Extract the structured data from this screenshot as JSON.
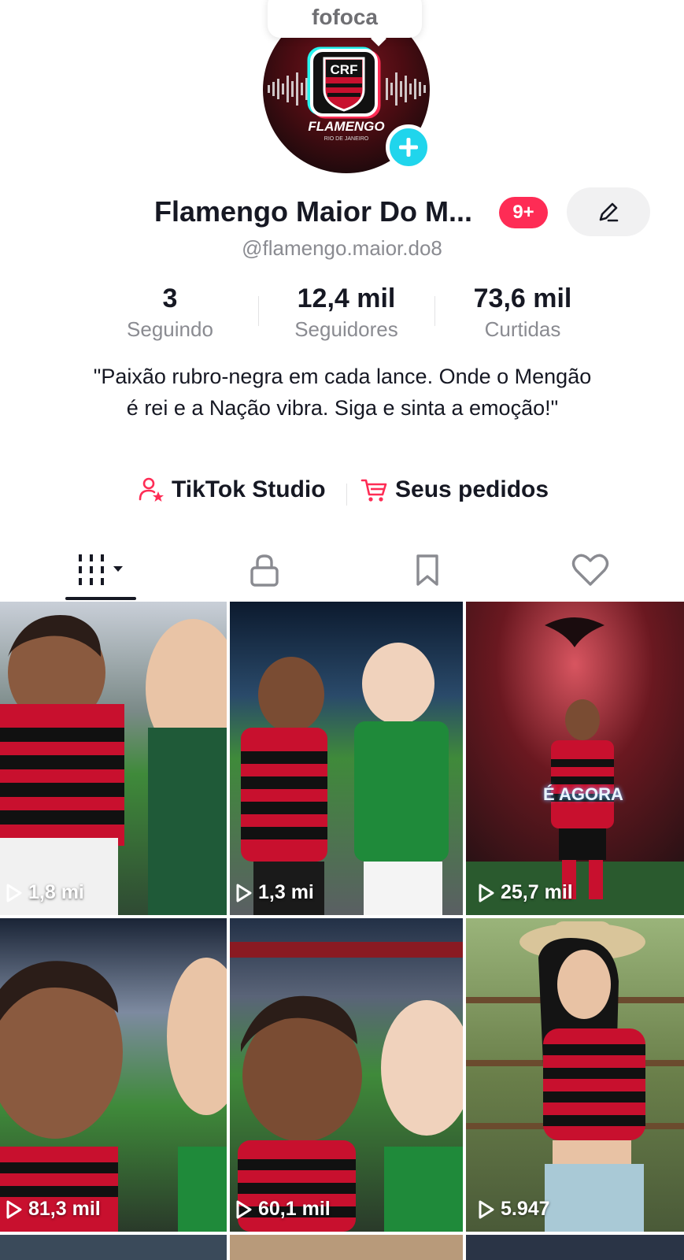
{
  "note": {
    "text": "fofoca"
  },
  "profile": {
    "avatar_logo_text": "CRF",
    "avatar_brand": "FLAMENGO",
    "avatar_sub": "RIO DE JANEIRO",
    "display_name": "Flamengo Maior Do M...",
    "notification_count": "9+",
    "username": "@flamengo.maior.do8",
    "bio": "\"Paixão rubro-negra em cada lance. Onde o Mengão é rei e a Nação vibra. Siga e sinta a emoção!\""
  },
  "stats": [
    {
      "value": "3",
      "label": "Seguindo"
    },
    {
      "value": "12,4 mil",
      "label": "Seguidores"
    },
    {
      "value": "73,6 mil",
      "label": "Curtidas"
    }
  ],
  "links": {
    "studio": "TikTok Studio",
    "orders": "Seus pedidos"
  },
  "tabs": [
    "videos-tab",
    "private-tab",
    "saved-tab",
    "liked-tab"
  ],
  "videos": [
    {
      "views": "1,8 mi"
    },
    {
      "views": "1,3 mi"
    },
    {
      "views": "25,7 mil",
      "overlay_text": "É AGORA"
    },
    {
      "views": "81,3 mil"
    },
    {
      "views": "60,1 mil"
    },
    {
      "views": "5.947"
    }
  ],
  "colors": {
    "accent": "#fe2c55",
    "badge_blue": "#20d5ec",
    "text_secondary": "#8a8b91",
    "flamengo_red": "#c8102e"
  }
}
